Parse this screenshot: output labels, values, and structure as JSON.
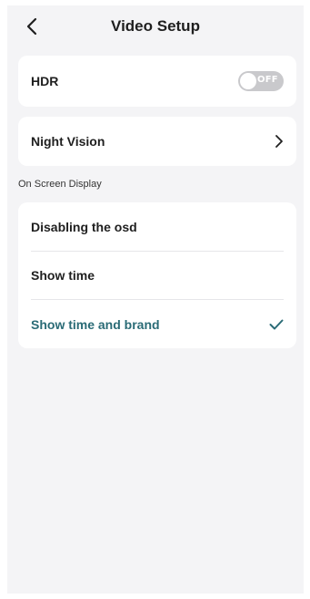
{
  "header": {
    "title": "Video Setup",
    "back_icon": "chevron-left-icon"
  },
  "hdr": {
    "label": "HDR",
    "toggle_state": "OFF"
  },
  "night_vision": {
    "label": "Night Vision",
    "arrow_icon": "chevron-right-icon"
  },
  "osd": {
    "section_title": "On Screen Display",
    "options": [
      {
        "label": "Disabling the osd",
        "selected": false
      },
      {
        "label": "Show time",
        "selected": false
      },
      {
        "label": "Show time and brand",
        "selected": true
      }
    ],
    "check_icon": "checkmark-icon"
  },
  "colors": {
    "background": "#f4f4f6",
    "card": "#ffffff",
    "toggle_off": "#c9c9cc",
    "selected_text": "#2a6b76",
    "divider": "#e6e6e9"
  }
}
